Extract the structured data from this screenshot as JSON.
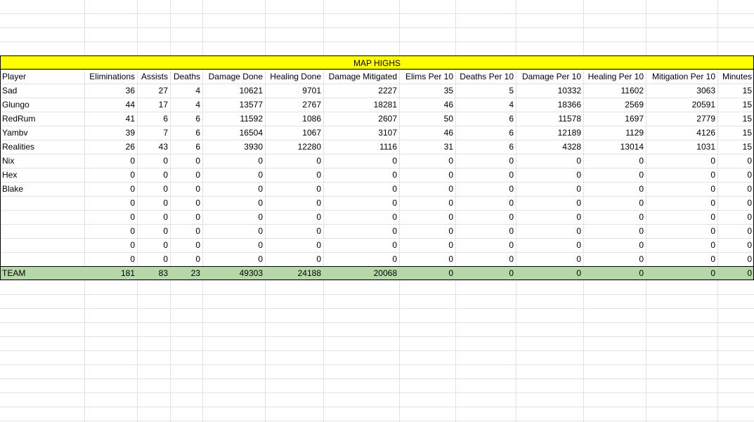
{
  "sheet": {
    "title": "MAP HIGHS",
    "headers": [
      "Player",
      "Eliminations",
      "Assists",
      "Deaths",
      "Damage Done",
      "Healing Done",
      "Damage Mitigated",
      "Elims Per 10",
      "Deaths Per 10",
      "Damage Per 10",
      "Healing Per 10",
      "Mitigation Per 10",
      "Minutes"
    ],
    "rows": [
      [
        "Sad",
        "36",
        "27",
        "4",
        "10621",
        "9701",
        "2227",
        "35",
        "5",
        "10332",
        "11602",
        "3063",
        "15"
      ],
      [
        "Glungo",
        "44",
        "17",
        "4",
        "13577",
        "2767",
        "18281",
        "46",
        "4",
        "18366",
        "2569",
        "20591",
        "15"
      ],
      [
        "RedRum",
        "41",
        "6",
        "6",
        "11592",
        "1086",
        "2607",
        "50",
        "6",
        "11578",
        "1697",
        "2779",
        "15"
      ],
      [
        "Yambv",
        "39",
        "7",
        "6",
        "16504",
        "1067",
        "3107",
        "46",
        "6",
        "12189",
        "1129",
        "4126",
        "15"
      ],
      [
        "Realities",
        "26",
        "43",
        "6",
        "3930",
        "12280",
        "1116",
        "31",
        "6",
        "4328",
        "13014",
        "1031",
        "15"
      ],
      [
        "Nix",
        "0",
        "0",
        "0",
        "0",
        "0",
        "0",
        "0",
        "0",
        "0",
        "0",
        "0",
        "0"
      ],
      [
        "Hex",
        "0",
        "0",
        "0",
        "0",
        "0",
        "0",
        "0",
        "0",
        "0",
        "0",
        "0",
        "0"
      ],
      [
        "Blake",
        "0",
        "0",
        "0",
        "0",
        "0",
        "0",
        "0",
        "0",
        "0",
        "0",
        "0",
        "0"
      ],
      [
        "",
        "0",
        "0",
        "0",
        "0",
        "0",
        "0",
        "0",
        "0",
        "0",
        "0",
        "0",
        "0"
      ],
      [
        "",
        "0",
        "0",
        "0",
        "0",
        "0",
        "0",
        "0",
        "0",
        "0",
        "0",
        "0",
        "0"
      ],
      [
        "",
        "0",
        "0",
        "0",
        "0",
        "0",
        "0",
        "0",
        "0",
        "0",
        "0",
        "0",
        "0"
      ],
      [
        "",
        "0",
        "0",
        "0",
        "0",
        "0",
        "0",
        "0",
        "0",
        "0",
        "0",
        "0",
        "0"
      ],
      [
        "",
        "0",
        "0",
        "0",
        "0",
        "0",
        "0",
        "0",
        "0",
        "0",
        "0",
        "0",
        "0"
      ]
    ],
    "team": [
      "TEAM",
      "181",
      "83",
      "23",
      "49303",
      "24188",
      "20068",
      "0",
      "0",
      "0",
      "0",
      "0",
      "0"
    ],
    "colors": {
      "title_bg": "#ffff00",
      "team_bg": "#b6d7a8",
      "grid": "#e2e2e2"
    }
  }
}
